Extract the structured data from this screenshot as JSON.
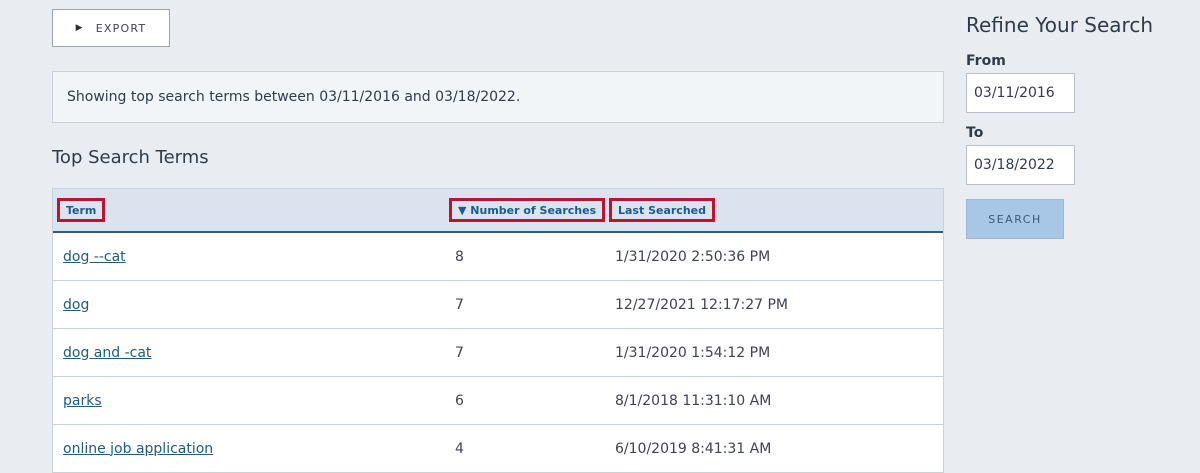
{
  "toolbar": {
    "export_label": "EXPORT",
    "export_icon": "play-triangle"
  },
  "info": {
    "text": "Showing top search terms between 03/11/2016 and 03/18/2022."
  },
  "section_title": "Top Search Terms",
  "table": {
    "columns": [
      "Term",
      "▼ Number of Searches",
      "Last Searched"
    ],
    "rows": [
      {
        "term": "dog --cat",
        "count": "8",
        "last": "1/31/2020 2:50:36 PM"
      },
      {
        "term": "dog",
        "count": "7",
        "last": "12/27/2021 12:17:27 PM"
      },
      {
        "term": "dog and -cat",
        "count": "7",
        "last": "1/31/2020 1:54:12 PM"
      },
      {
        "term": "parks",
        "count": "6",
        "last": "8/1/2018 11:31:10 AM"
      },
      {
        "term": "online job application",
        "count": "4",
        "last": "6/10/2019 8:41:31 AM"
      }
    ]
  },
  "sidebar": {
    "title": "Refine Your Search",
    "from_label": "From",
    "from_value": "03/11/2016",
    "to_label": "To",
    "to_value": "03/18/2022",
    "search_label": "SEARCH"
  },
  "colors": {
    "background": "#e9edf2",
    "link": "#1f5a8c",
    "header_highlight": "#c4102a",
    "search_button": "#a8c6e6"
  }
}
